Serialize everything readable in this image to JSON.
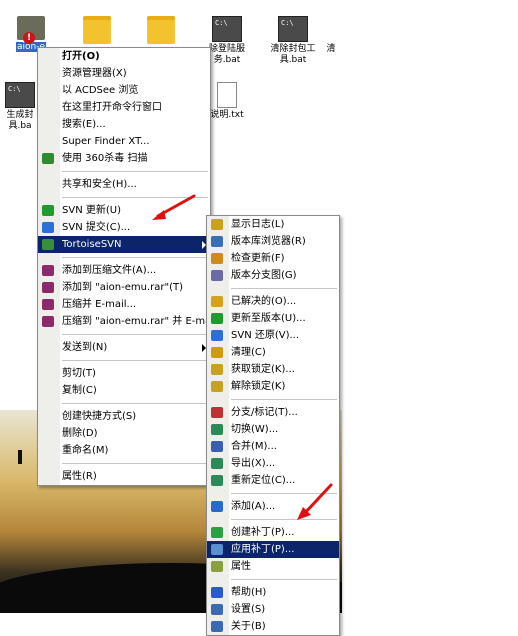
{
  "desktop": {
    "icons": [
      {
        "label": "aion-e",
        "type": "archive"
      },
      {
        "label": "",
        "type": "folder"
      },
      {
        "label": "",
        "type": "folder"
      },
      {
        "label": "除登陆服\n务.bat",
        "type": "cmd"
      },
      {
        "label": "清除封包工\n具.bat",
        "type": "cmd"
      },
      {
        "label": "清",
        "type": "text"
      },
      {
        "label": "生成封\n具.ba",
        "type": "cmd"
      },
      {
        "label": "说明.txt",
        "type": "txt"
      }
    ]
  },
  "context_menu": {
    "items": [
      {
        "label": "打开(O)",
        "bold": true
      },
      {
        "label": "资源管理器(X)"
      },
      {
        "label": "以 ACDSee 浏览"
      },
      {
        "label": "在这里打开命令行窗口"
      },
      {
        "label": "搜索(E)..."
      },
      {
        "label": "Super Finder XT..."
      },
      {
        "label": "使用 360杀毒 扫描",
        "icon": "shield-icon"
      },
      {
        "sep": true
      },
      {
        "label": "共享和安全(H)..."
      },
      {
        "sep": true
      },
      {
        "label": "SVN 更新(U)",
        "icon": "svn-update-icon"
      },
      {
        "label": "SVN 提交(C)...",
        "icon": "svn-commit-icon"
      },
      {
        "label": "TortoiseSVN",
        "icon": "tortoise-icon",
        "highlight": true,
        "submenu": true
      },
      {
        "sep": true
      },
      {
        "label": "添加到压缩文件(A)...",
        "icon": "winrar-icon"
      },
      {
        "label": "添加到 \"aion-emu.rar\"(T)",
        "icon": "winrar-icon"
      },
      {
        "label": "压缩并 E-mail...",
        "icon": "winrar-icon"
      },
      {
        "label": "压缩到 \"aion-emu.rar\" 并 E-mail",
        "icon": "winrar-icon"
      },
      {
        "sep": true
      },
      {
        "label": "发送到(N)",
        "submenu": true
      },
      {
        "sep": true
      },
      {
        "label": "剪切(T)"
      },
      {
        "label": "复制(C)"
      },
      {
        "sep": true
      },
      {
        "label": "创建快捷方式(S)"
      },
      {
        "label": "删除(D)"
      },
      {
        "label": "重命名(M)"
      },
      {
        "sep": true
      },
      {
        "label": "属性(R)"
      }
    ]
  },
  "submenu": {
    "items": [
      {
        "label": "显示日志(L)",
        "icon": "log-icon"
      },
      {
        "label": "版本库浏览器(R)",
        "icon": "repo-browser-icon"
      },
      {
        "label": "检查更新(F)",
        "icon": "check-modifications-icon"
      },
      {
        "label": "版本分支图(G)",
        "icon": "revision-graph-icon"
      },
      {
        "sep": true
      },
      {
        "label": "已解决的(O)...",
        "icon": "resolved-icon"
      },
      {
        "label": "更新至版本(U)...",
        "icon": "update-revision-icon"
      },
      {
        "label": "SVN 还原(V)...",
        "icon": "revert-icon"
      },
      {
        "label": "清理(C)",
        "icon": "cleanup-icon"
      },
      {
        "label": "获取锁定(K)...",
        "icon": "lock-icon"
      },
      {
        "label": "解除锁定(K)",
        "icon": "unlock-icon"
      },
      {
        "sep": true
      },
      {
        "label": "分支/标记(T)...",
        "icon": "branch-icon"
      },
      {
        "label": "切换(W)...",
        "icon": "switch-icon"
      },
      {
        "label": "合并(M)...",
        "icon": "merge-icon"
      },
      {
        "label": "导出(X)...",
        "icon": "export-icon"
      },
      {
        "label": "重新定位(C)...",
        "icon": "relocate-icon"
      },
      {
        "sep": true
      },
      {
        "label": "添加(A)...",
        "icon": "add-icon"
      },
      {
        "sep": true
      },
      {
        "label": "创建补丁(P)...",
        "icon": "create-patch-icon"
      },
      {
        "label": "应用补丁(P)...",
        "icon": "apply-patch-icon",
        "highlight": true
      },
      {
        "label": "属性",
        "icon": "properties-icon"
      },
      {
        "sep": true
      },
      {
        "label": "帮助(H)",
        "icon": "help-icon"
      },
      {
        "label": "设置(S)",
        "icon": "settings-icon"
      },
      {
        "label": "关于(B)",
        "icon": "about-icon"
      }
    ]
  },
  "colors": {
    "highlight": "#0b246a",
    "annotation_arrow": "#e01010"
  }
}
